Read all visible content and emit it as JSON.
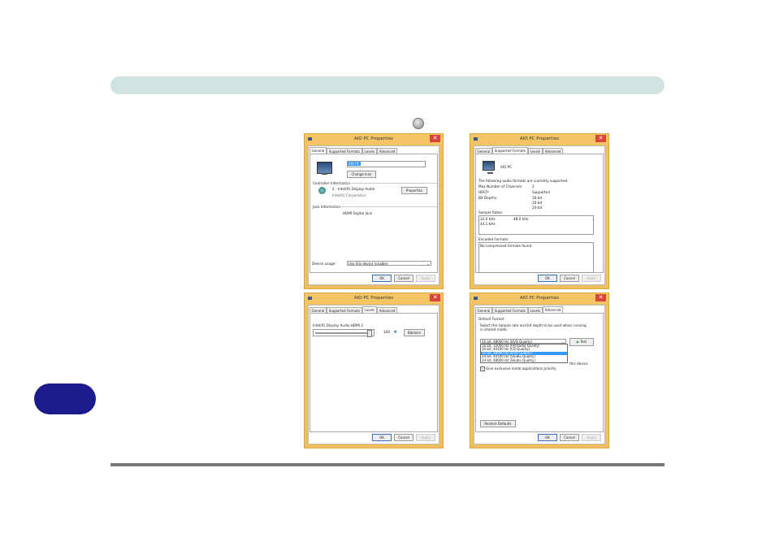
{
  "dialogs": {
    "general": {
      "title": "AIO PC Properties",
      "tabs": [
        "General",
        "Supported Formats",
        "Levels",
        "Advanced"
      ],
      "device_name_value": "AIO PC",
      "change_icon_button": "Change Icon",
      "controller_info_label": "Controller Information",
      "controller_name": "2 - Intel(R) Display Audio",
      "controller_vendor": "Intel(R) Corporation",
      "properties_button": "Properties",
      "jack_info_label": "Jack Information",
      "jack_value": "HDMI Digital Jack",
      "device_usage_label": "Device usage:",
      "device_usage_value": "Use this device (enable)",
      "ok_button": "OK",
      "cancel_button": "Cancel",
      "apply_button": "Apply"
    },
    "supported_formats": {
      "title": "AIO PC Properties",
      "tabs": [
        "General",
        "Supported Formats",
        "Levels",
        "Advanced"
      ],
      "device_label": "AIO PC",
      "intro_text": "The following audio formats are currently supported.",
      "max_channels_label": "Max Number of Channels:",
      "max_channels_value": "2",
      "hdcp_label": "HDCP:",
      "hdcp_value": "Supported",
      "bit_depths_label": "Bit Depths:",
      "bit_depths": [
        "16-bit",
        "20-bit",
        "24-bit"
      ],
      "sample_rates_label": "Sample Rates:",
      "sample_rates": [
        "32.0 kHz",
        "48.0 kHz",
        "44.1 kHz"
      ],
      "encoded_formats_label": "Encoded Formats:",
      "encoded_formats_value": "No compressed formats found.",
      "ok_button": "OK",
      "cancel_button": "Cancel",
      "apply_button": "Apply"
    },
    "levels": {
      "title": "AIO PC Properties",
      "tabs": [
        "General",
        "Supported Formats",
        "Levels",
        "Advanced"
      ],
      "device_label": "Intel(R) Display Audio HDMI 2",
      "volume_value": "100",
      "volume_level": 1.0,
      "balance_button": "Balance",
      "ok_button": "OK",
      "cancel_button": "Cancel",
      "apply_button": "Apply"
    },
    "advanced": {
      "title": "AIO PC Properties",
      "tabs": [
        "General",
        "Supported Formats",
        "Levels",
        "Advanced"
      ],
      "default_format_label": "Default Format",
      "default_format_desc_1": "Select the sample rate and bit depth to be used when running",
      "default_format_desc_2": "in shared mode.",
      "format_selected": "16 bit, 48000 Hz (DVD Quality)",
      "test_button": "Test",
      "format_options": [
        "16 bit, 32000 Hz (FM Radio Quality)",
        "16 bit, 44100 Hz (CD Quality)",
        "16 bit, 48000 Hz (DVD Quality)",
        "24 bit, 44100 Hz (Studio Quality)",
        "24 bit, 48000 Hz (Studio Quality)"
      ],
      "exclusive_fragment": "this device",
      "exclusive_priority_label": "Give exclusive mode applications priority",
      "restore_defaults_button": "Restore Defaults",
      "ok_button": "OK",
      "cancel_button": "Cancel",
      "apply_button": "Apply"
    }
  }
}
